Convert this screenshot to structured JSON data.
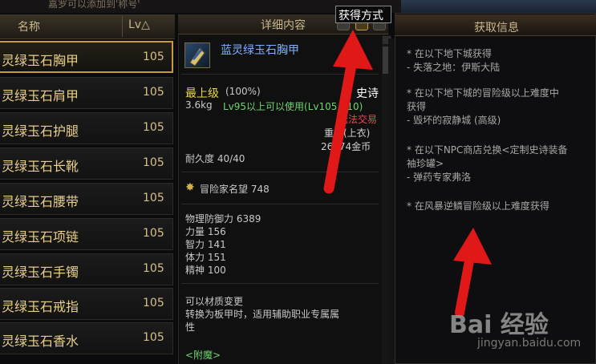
{
  "top": {
    "text": "嘉罗可以添加到'称号'"
  },
  "list": {
    "headers": {
      "name": "名称",
      "lv": "Lv△"
    },
    "rows": [
      {
        "name": "灵绿玉石胸甲",
        "lv": "105",
        "selected": true
      },
      {
        "name": "灵绿玉石肩甲",
        "lv": "105"
      },
      {
        "name": "灵绿玉石护腿",
        "lv": "105"
      },
      {
        "name": "灵绿玉石长靴",
        "lv": "105"
      },
      {
        "name": "灵绿玉石腰带",
        "lv": "105"
      },
      {
        "name": "灵绿玉石项链",
        "lv": "105"
      },
      {
        "name": "灵绿玉石手镯",
        "lv": "105"
      },
      {
        "name": "灵绿玉石戒指",
        "lv": "105"
      },
      {
        "name": "灵绿玉石香水",
        "lv": "105"
      }
    ]
  },
  "detail": {
    "header": "详细内容",
    "tooltip": "获得方式",
    "item_name": "蓝灵绿玉石胸甲",
    "grade": "最上级",
    "grade_pct": "(100%)",
    "rarity": "史诗",
    "weight": "3.6kg",
    "requirement": "Lv95以上可以使用(Lv105 - 10)",
    "trade": "无法交易",
    "slot": "重甲(上衣)",
    "price": "26574金币",
    "durability": "耐久度 40/40",
    "fame": "冒险家名望 748",
    "stats": [
      "物理防御力 6389",
      "力量 156",
      "智力 141",
      "体力 151",
      "精神 100"
    ],
    "material_1": "可以材质变更",
    "material_2": "转换为板甲时，适用辅助职业专属属",
    "material_3": "性",
    "enchant": "<附魔>"
  },
  "acquire": {
    "title": "获取信息",
    "lines": [
      "* 在以下地下城获得",
      "- 失落之地：伊斯大陆",
      "",
      "* 在以下地下城的冒险级以上难度中",
      "获得",
      "- 毁坏的寂静城 (高级)",
      "",
      "* 在以下NPC商店兑换<定制史诗装备",
      "袖珍罐>",
      "- 弹药专家弗洛",
      "",
      "* 在风暴逆鳞冒险级以上难度获得"
    ]
  },
  "watermark": {
    "logo": "Bai 经验",
    "url": "jingyan.baidu.com"
  },
  "colors": {
    "accent": "#c89a3c",
    "arrow": "#e01818",
    "epic": "#7fb0ff"
  }
}
